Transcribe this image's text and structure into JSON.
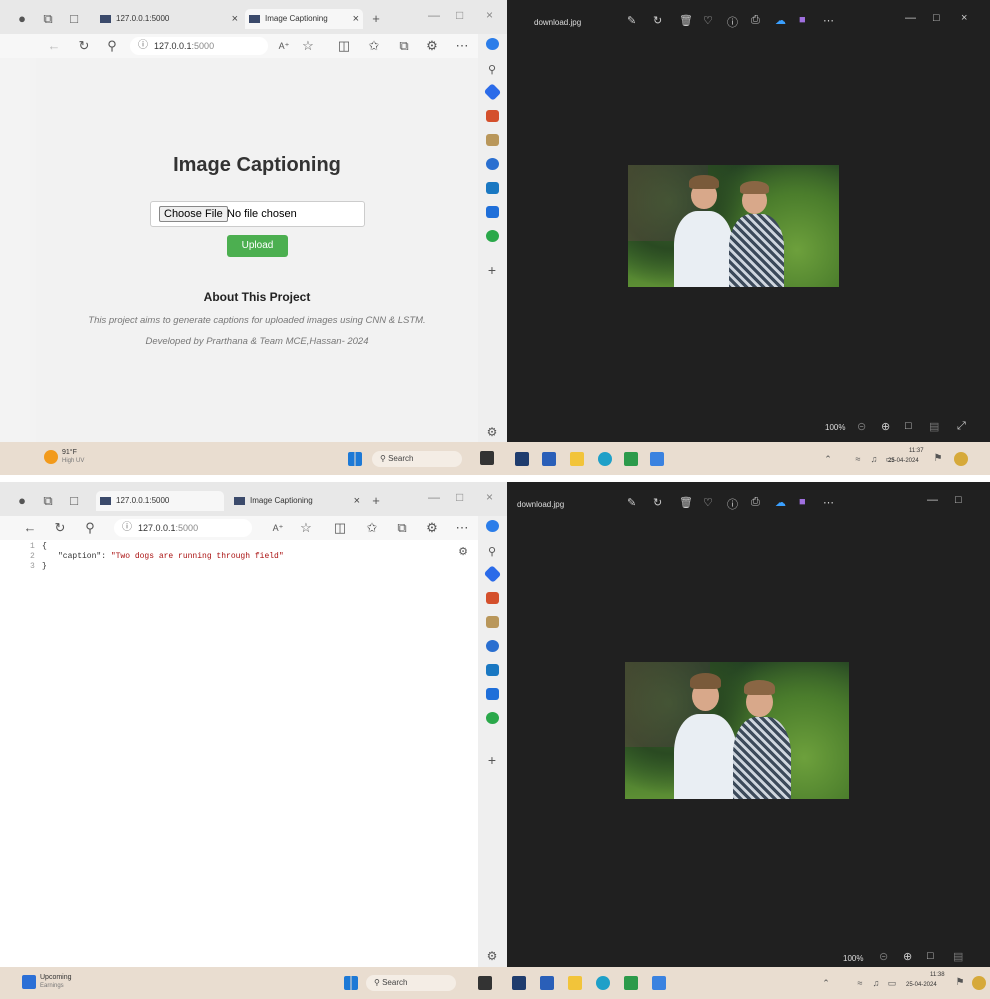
{
  "screenshots": [
    {
      "browser": {
        "tabs": [
          {
            "label": "127.0.0.1:5000"
          },
          {
            "label": "Image Captioning"
          }
        ],
        "address": {
          "host": "127.0.0.1",
          "port": ":5000"
        },
        "page": {
          "title": "Image Captioning",
          "file_button": "Choose File",
          "file_status": "No file chosen",
          "upload_button": "Upload",
          "about_heading": "About This Project",
          "about_text": "This project aims to generate captions for uploaded images using CNN & LSTM.",
          "credit": "Developed by Prarthana & Team MCE,Hassan- 2024"
        }
      },
      "viewer": {
        "filename": "download.jpg",
        "zoom": "100%"
      },
      "taskbar": {
        "weather_temp": "91°F",
        "weather_desc": "High UV",
        "search": "Search",
        "time": "11:37",
        "date": "25-04-2024"
      }
    },
    {
      "browser": {
        "tabs": [
          {
            "label": "127.0.0.1:5000"
          },
          {
            "label": "Image Captioning"
          }
        ],
        "address": {
          "host": "127.0.0.1",
          "port": ":5000"
        },
        "json_lines": [
          {
            "num": "1",
            "text": "{"
          },
          {
            "num": "2",
            "key": "\"caption\": ",
            "value": "\"Two dogs are running through field\""
          },
          {
            "num": "3",
            "text": "}"
          }
        ]
      },
      "viewer": {
        "filename": "download.jpg",
        "zoom": "100%"
      },
      "taskbar": {
        "weather_temp": "Upcoming",
        "weather_desc": "Earnings",
        "search": "Search",
        "time": "11:38",
        "date": "25-04-2024"
      }
    }
  ],
  "colors": {
    "upload_button": "#4caf50",
    "viewer_bg": "#202020",
    "json_string": "#a11111"
  }
}
